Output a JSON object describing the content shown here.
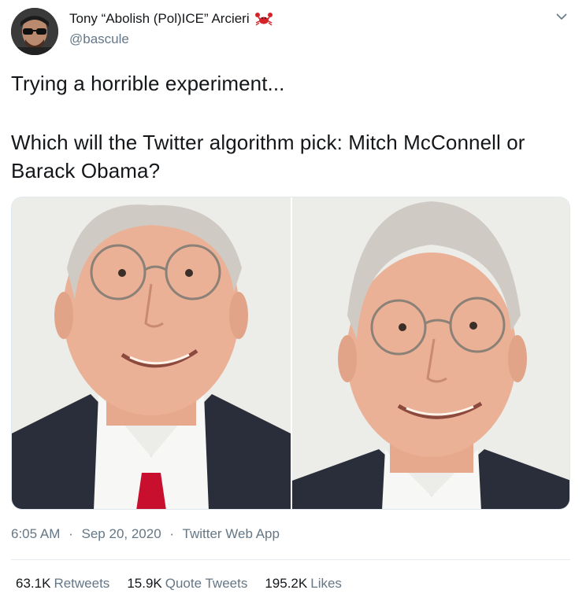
{
  "author": {
    "display_name": "Tony “Abolish (Pol)ICE” Arcieri",
    "handle": "@bascule",
    "emoji_icon": "crab-icon"
  },
  "tweet": {
    "line1": "Trying a horrible experiment...",
    "line2": "Which will the Twitter algorithm pick: Mitch McConnell or",
    "line3": "Barack Obama?"
  },
  "media": {
    "images": [
      {
        "name": "photo-left",
        "subject": "portrait"
      },
      {
        "name": "photo-right",
        "subject": "portrait"
      }
    ]
  },
  "meta": {
    "time": "6:05 AM",
    "date": "Sep 20, 2020",
    "separator": "·",
    "source": "Twitter Web App"
  },
  "stats": {
    "retweets_count": "63.1K",
    "retweets_label": "Retweets",
    "quotes_count": "15.9K",
    "quotes_label": "Quote Tweets",
    "likes_count": "195.2K",
    "likes_label": "Likes"
  },
  "colors": {
    "text": "#14171a",
    "secondary": "#657786",
    "divider": "#e6ecf0"
  }
}
